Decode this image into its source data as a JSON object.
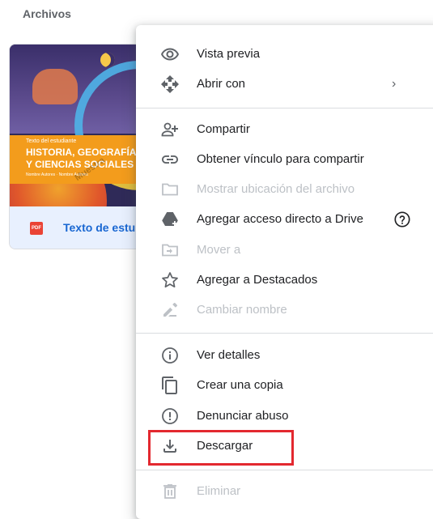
{
  "section": {
    "title": "Archivos"
  },
  "file_card": {
    "thumbnail": {
      "small_text": "Texto del estudiante",
      "title": "HISTORIA, GEOGRAFÍA\nY CIENCIAS SOCIALES",
      "credits": "Nombre Autores · Nombre Autores",
      "watermark": "Muestra"
    },
    "file_type_badge": "PDF",
    "name": "Texto de estu"
  },
  "context_menu": {
    "items": [
      {
        "label": "Vista previa",
        "icon": "eye-icon",
        "enabled": true
      },
      {
        "label": "Abrir con",
        "icon": "open-with-icon",
        "enabled": true,
        "submenu_arrow": "›"
      },
      {
        "label": "Compartir",
        "icon": "person-add-icon",
        "enabled": true
      },
      {
        "label": "Obtener vínculo para compartir",
        "icon": "link-icon",
        "enabled": true
      },
      {
        "label": "Mostrar ubicación del archivo",
        "icon": "folder-icon",
        "enabled": false
      },
      {
        "label": "Agregar acceso directo a Drive",
        "icon": "drive-add-icon",
        "enabled": true,
        "help_icon": "help-icon"
      },
      {
        "label": "Mover a",
        "icon": "move-to-folder-icon",
        "enabled": false
      },
      {
        "label": "Agregar a Destacados",
        "icon": "star-icon",
        "enabled": true
      },
      {
        "label": "Cambiar nombre",
        "icon": "pencil-icon",
        "enabled": false
      },
      {
        "label": "Ver detalles",
        "icon": "info-icon",
        "enabled": true
      },
      {
        "label": "Crear una copia",
        "icon": "copy-icon",
        "enabled": true
      },
      {
        "label": "Denunciar abuso",
        "icon": "report-icon",
        "enabled": true
      },
      {
        "label": "Descargar",
        "icon": "download-icon",
        "enabled": true,
        "highlighted": true
      },
      {
        "label": "Eliminar",
        "icon": "trash-icon",
        "enabled": false
      }
    ]
  },
  "colors": {
    "text": "#202124",
    "disabled_text": "#bdc1c6",
    "icon": "#5f6368",
    "disabled_icon": "#bdc1c6",
    "file_name": "#1967d2",
    "highlight_border": "#e3282f",
    "pdf_badge": "#ea4335"
  }
}
